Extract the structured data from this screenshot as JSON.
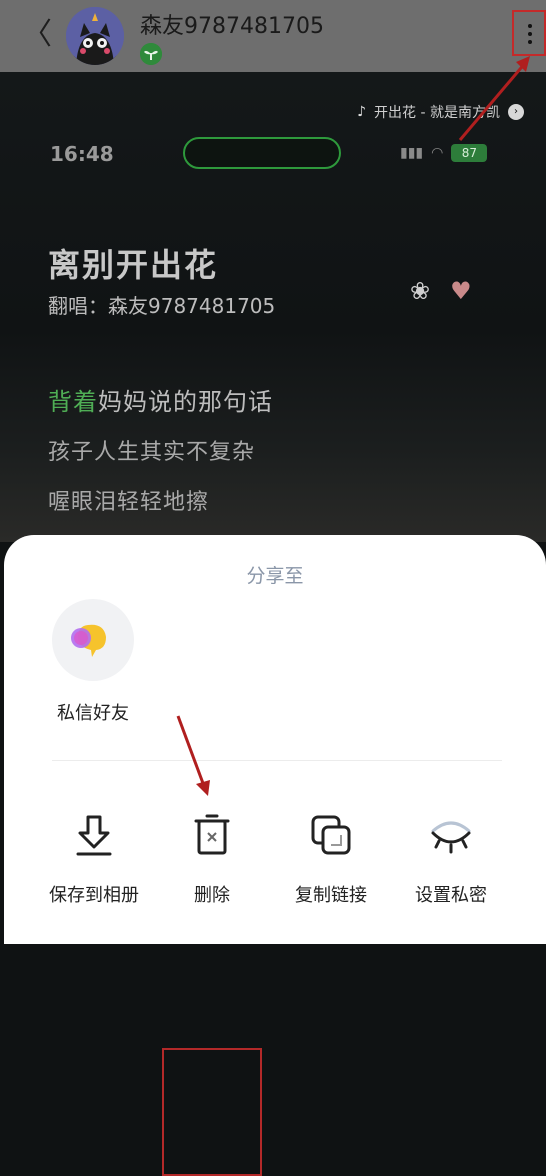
{
  "header": {
    "back_glyph": "〈",
    "username": "森友9787481705",
    "avatar_icon": "cat-avatar",
    "badge_icon": "sprout-level-badge",
    "more_icon": "more-vertical-icon"
  },
  "video": {
    "music_note": "♪",
    "music_title": "开出花 - 就是南方凯",
    "play_glyph": "›",
    "status_time": "16:48",
    "battery": "87",
    "song_title": "离别开出花",
    "cover_singer": "翻唱：森友9787481705",
    "lyric_line1_highlight": "背着",
    "lyric_line1_rest": "妈妈说的那句话",
    "lyric_line2": "孩子人生其实不复杂",
    "lyric_line3": "喔眼泪轻轻地擦"
  },
  "sheet": {
    "title": "分享至",
    "dm_friend_label": "私信好友",
    "actions": [
      {
        "label": "保存到相册",
        "icon": "download-icon"
      },
      {
        "label": "删除",
        "icon": "trash-icon"
      },
      {
        "label": "复制链接",
        "icon": "copy-link-icon"
      },
      {
        "label": "设置私密",
        "icon": "closed-eye-icon"
      }
    ]
  },
  "colors": {
    "highlight_red": "#c42a2a",
    "lyric_green": "#4fae55",
    "sheet_bg": "#ffffff"
  }
}
